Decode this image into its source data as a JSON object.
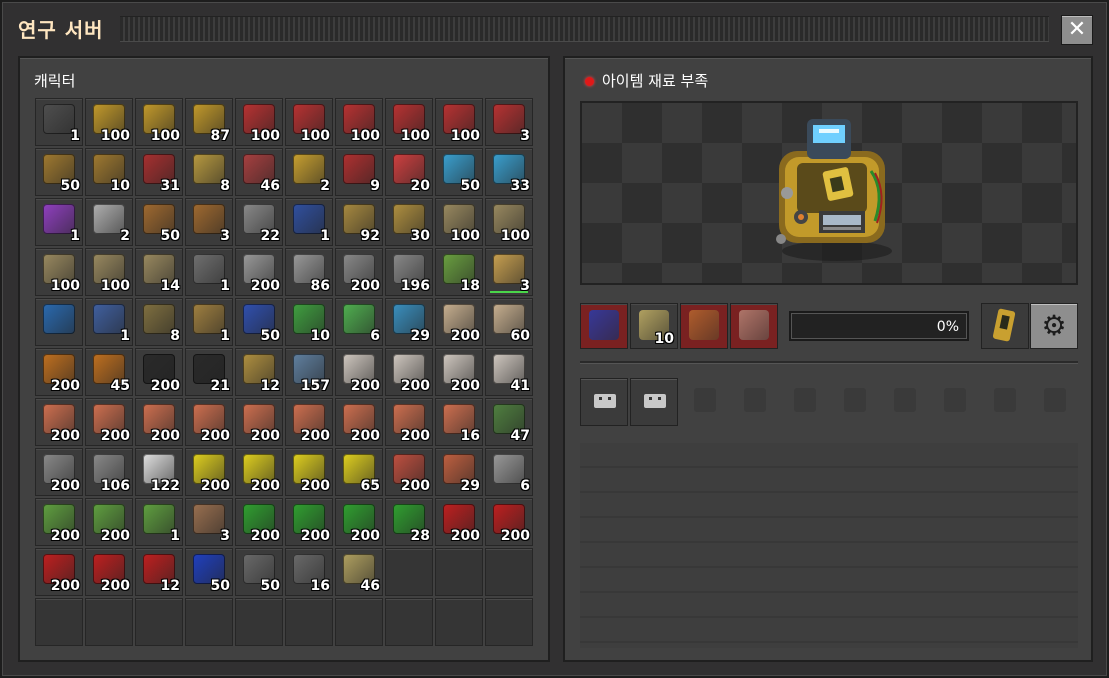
{
  "window": {
    "title": "연구 서버",
    "close_label": "✕"
  },
  "inventory": {
    "label": "캐릭터",
    "slots": [
      {
        "icon": "steel-chest-icon",
        "color": "#4f4f4f",
        "count": "1"
      },
      {
        "icon": "transport-belt-icon",
        "color": "#c39a2b",
        "count": "100"
      },
      {
        "icon": "transport-belt-icon",
        "color": "#c39a2b",
        "count": "100"
      },
      {
        "icon": "transport-belt-icon",
        "color": "#c39a2b",
        "count": "87"
      },
      {
        "icon": "fast-transport-belt-icon",
        "color": "#b93232",
        "count": "100"
      },
      {
        "icon": "fast-transport-belt-icon",
        "color": "#b93232",
        "count": "100"
      },
      {
        "icon": "fast-transport-belt-icon",
        "color": "#b93232",
        "count": "100"
      },
      {
        "icon": "fast-transport-belt-icon",
        "color": "#b93232",
        "count": "100"
      },
      {
        "icon": "fast-transport-belt-icon",
        "color": "#b93232",
        "count": "100"
      },
      {
        "icon": "fast-transport-belt-icon",
        "color": "#b93232",
        "count": "3"
      },
      {
        "icon": "underground-belt-icon",
        "color": "#a07a30",
        "count": "50"
      },
      {
        "icon": "underground-belt-icon",
        "color": "#a07a30",
        "count": "10"
      },
      {
        "icon": "fast-underground-belt-icon",
        "color": "#a83030",
        "count": "31"
      },
      {
        "icon": "splitter-icon",
        "color": "#b89a40",
        "count": "8"
      },
      {
        "icon": "fast-splitter-icon",
        "color": "#a84040",
        "count": "46"
      },
      {
        "icon": "inserter-icon",
        "color": "#c8a030",
        "count": "2"
      },
      {
        "icon": "fast-inserter-icon",
        "color": "#b03030",
        "count": "9"
      },
      {
        "icon": "long-handed-inserter-icon",
        "color": "#d04040",
        "count": "20"
      },
      {
        "icon": "fast-inserter-icon",
        "color": "#3aa0d0",
        "count": "50"
      },
      {
        "icon": "fast-inserter-icon",
        "color": "#3aa0d0",
        "count": "33"
      },
      {
        "icon": "filter-inserter-icon",
        "color": "#9040c0",
        "count": "1"
      },
      {
        "icon": "burner-inserter-icon",
        "color": "#b0b0b0",
        "count": "2"
      },
      {
        "icon": "small-electric-pole-icon",
        "color": "#a06a30",
        "count": "50"
      },
      {
        "icon": "small-electric-pole-icon",
        "color": "#a06a30",
        "count": "3"
      },
      {
        "icon": "big-electric-pole-icon",
        "color": "#8a8a8a",
        "count": "22"
      },
      {
        "icon": "substation-icon",
        "color": "#3050a0",
        "count": "1"
      },
      {
        "icon": "pipe-icon",
        "color": "#a88a40",
        "count": "92"
      },
      {
        "icon": "pipe-to-ground-icon",
        "color": "#b09040",
        "count": "30"
      },
      {
        "icon": "rail-icon",
        "color": "#9a8a60",
        "count": "100"
      },
      {
        "icon": "rail-icon",
        "color": "#9a8a60",
        "count": "100"
      },
      {
        "icon": "rail-icon",
        "color": "#9a8a60",
        "count": "100"
      },
      {
        "icon": "rail-icon",
        "color": "#9a8a60",
        "count": "100"
      },
      {
        "icon": "rail-icon",
        "color": "#9a8a60",
        "count": "14"
      },
      {
        "icon": "engine-unit-icon",
        "color": "#707070",
        "count": "1"
      },
      {
        "icon": "stone-brick-icon",
        "color": "#9a9a9a",
        "count": "200"
      },
      {
        "icon": "stone-brick-icon",
        "color": "#9a9a9a",
        "count": "86"
      },
      {
        "icon": "concrete-icon",
        "color": "#8a8a8a",
        "count": "200"
      },
      {
        "icon": "concrete-icon",
        "color": "#8a8a8a",
        "count": "196"
      },
      {
        "icon": "landfill-icon",
        "color": "#6aa040",
        "count": "18"
      },
      {
        "icon": "repair-pack-icon",
        "color": "#c8a050",
        "count": "3",
        "hotbar": true
      },
      {
        "icon": "blueprint-icon",
        "color": "#2a6ab0",
        "count": ""
      },
      {
        "icon": "armor-icon",
        "color": "#4060a0",
        "count": "1"
      },
      {
        "icon": "armor-icon",
        "color": "#807040",
        "count": "8"
      },
      {
        "icon": "turret-icon",
        "color": "#a08040",
        "count": "1"
      },
      {
        "icon": "gears-icon",
        "color": "#3050b0",
        "count": "50"
      },
      {
        "icon": "gears-icon",
        "color": "#40a040",
        "count": "10"
      },
      {
        "icon": "canisters-icon",
        "color": "#50b050",
        "count": "6"
      },
      {
        "icon": "flask-icon",
        "color": "#3a90c0",
        "count": "29"
      },
      {
        "icon": "stone-icon",
        "color": "#c8b090",
        "count": "200"
      },
      {
        "icon": "stone-icon",
        "color": "#c8b090",
        "count": "60"
      },
      {
        "icon": "wood-icon",
        "color": "#c07020",
        "count": "200"
      },
      {
        "icon": "wood-icon",
        "color": "#c07020",
        "count": "45"
      },
      {
        "icon": "coal-icon",
        "color": "#2a2a2a",
        "count": "200"
      },
      {
        "icon": "coal-icon",
        "color": "#2a2a2a",
        "count": "21"
      },
      {
        "icon": "copper-ore-icon",
        "color": "#b09040",
        "count": "12"
      },
      {
        "icon": "iron-ore-icon",
        "color": "#6080a0",
        "count": "157"
      },
      {
        "icon": "iron-plate-icon",
        "color": "#d0c8c0",
        "count": "200"
      },
      {
        "icon": "iron-plate-icon",
        "color": "#d0c8c0",
        "count": "200"
      },
      {
        "icon": "iron-plate-icon",
        "color": "#d0c8c0",
        "count": "200"
      },
      {
        "icon": "iron-plate-icon",
        "color": "#d0c8c0",
        "count": "41"
      },
      {
        "icon": "copper-plate-icon",
        "color": "#d07050",
        "count": "200"
      },
      {
        "icon": "copper-plate-icon",
        "color": "#d07050",
        "count": "200"
      },
      {
        "icon": "copper-plate-icon",
        "color": "#d07050",
        "count": "200"
      },
      {
        "icon": "copper-plate-icon",
        "color": "#d07050",
        "count": "200"
      },
      {
        "icon": "copper-plate-icon",
        "color": "#d07050",
        "count": "200"
      },
      {
        "icon": "copper-plate-icon",
        "color": "#d07050",
        "count": "200"
      },
      {
        "icon": "copper-plate-icon",
        "color": "#d07050",
        "count": "200"
      },
      {
        "icon": "copper-plate-icon",
        "color": "#d07050",
        "count": "200"
      },
      {
        "icon": "copper-plate-icon",
        "color": "#d07050",
        "count": "16"
      },
      {
        "icon": "solid-fuel-icon",
        "color": "#508040",
        "count": "47"
      },
      {
        "icon": "steel-plate-icon",
        "color": "#8a8a8a",
        "count": "200"
      },
      {
        "icon": "steel-plate-icon",
        "color": "#8a8a8a",
        "count": "106"
      },
      {
        "icon": "plastic-bar-icon",
        "color": "#e0e0e0",
        "count": "122"
      },
      {
        "icon": "sulfur-icon",
        "color": "#e0d020",
        "count": "200"
      },
      {
        "icon": "sulfur-icon",
        "color": "#e0d020",
        "count": "200"
      },
      {
        "icon": "sulfur-icon",
        "color": "#e0d020",
        "count": "200"
      },
      {
        "icon": "sulfur-icon",
        "color": "#e0d020",
        "count": "65"
      },
      {
        "icon": "battery-icon",
        "color": "#c05040",
        "count": "200"
      },
      {
        "icon": "copper-cable-icon",
        "color": "#c06040",
        "count": "29"
      },
      {
        "icon": "iron-stick-icon",
        "color": "#9a9a9a",
        "count": "6"
      },
      {
        "icon": "electronic-circuit-bundle-icon",
        "color": "#60a040",
        "count": "200"
      },
      {
        "icon": "electronic-circuit-bundle-icon",
        "color": "#60a040",
        "count": "200"
      },
      {
        "icon": "electronic-circuit-bundle-icon",
        "color": "#60a040",
        "count": "1"
      },
      {
        "icon": "iron-gear-wheel-icon",
        "color": "#9a7050",
        "count": "3"
      },
      {
        "icon": "electronic-circuit-icon",
        "color": "#30a030",
        "count": "200"
      },
      {
        "icon": "electronic-circuit-icon",
        "color": "#30a030",
        "count": "200"
      },
      {
        "icon": "electronic-circuit-icon",
        "color": "#30a030",
        "count": "200"
      },
      {
        "icon": "electronic-circuit-icon",
        "color": "#30a030",
        "count": "28"
      },
      {
        "icon": "advanced-circuit-icon",
        "color": "#c02020",
        "count": "200"
      },
      {
        "icon": "advanced-circuit-icon",
        "color": "#c02020",
        "count": "200"
      },
      {
        "icon": "advanced-circuit-icon",
        "color": "#c02020",
        "count": "200"
      },
      {
        "icon": "advanced-circuit-icon",
        "color": "#c02020",
        "count": "200"
      },
      {
        "icon": "advanced-circuit-icon",
        "color": "#c02020",
        "count": "12"
      },
      {
        "icon": "processing-unit-icon",
        "color": "#2040c0",
        "count": "50"
      },
      {
        "icon": "engine-unit-icon",
        "color": "#6a6a6a",
        "count": "50"
      },
      {
        "icon": "engine-unit-icon",
        "color": "#6a6a6a",
        "count": "16"
      },
      {
        "icon": "flying-robot-frame-icon",
        "color": "#b0a060",
        "count": "46"
      },
      {
        "icon": "",
        "color": "",
        "count": ""
      },
      {
        "icon": "",
        "color": "",
        "count": ""
      },
      {
        "icon": "",
        "color": "",
        "count": ""
      },
      {
        "icon": "",
        "color": "",
        "count": ""
      },
      {
        "icon": "",
        "color": "",
        "count": ""
      },
      {
        "icon": "",
        "color": "",
        "count": ""
      },
      {
        "icon": "",
        "color": "",
        "count": ""
      },
      {
        "icon": "",
        "color": "",
        "count": ""
      },
      {
        "icon": "",
        "color": "",
        "count": ""
      },
      {
        "icon": "",
        "color": "",
        "count": ""
      },
      {
        "icon": "",
        "color": "",
        "count": ""
      },
      {
        "icon": "",
        "color": "",
        "count": ""
      },
      {
        "icon": "",
        "color": "",
        "count": ""
      }
    ]
  },
  "lab": {
    "status_text": "아이템 재료 부족",
    "status_color": "#e01818",
    "inputs": [
      {
        "icon": "processing-unit-icon",
        "color": "#2040c0",
        "count": "",
        "missing": true
      },
      {
        "icon": "flying-robot-frame-icon",
        "color": "#b0a060",
        "count": "10",
        "missing": false
      },
      {
        "icon": "rocket-part-icon",
        "color": "#c07030",
        "count": "",
        "missing": true
      },
      {
        "icon": "satellite-icon",
        "color": "#c09080",
        "count": "",
        "missing": true
      }
    ],
    "progress": {
      "value": 0,
      "text": "0%"
    },
    "module_icon": "speed-module-icon",
    "settings_icon": "gear-icon",
    "output_slots": [
      {
        "filled": true
      },
      {
        "filled": true
      },
      {
        "filled": false
      },
      {
        "filled": false
      },
      {
        "filled": false
      },
      {
        "filled": false
      },
      {
        "filled": false
      },
      {
        "filled": false
      },
      {
        "filled": false
      },
      {
        "filled": false
      }
    ]
  }
}
